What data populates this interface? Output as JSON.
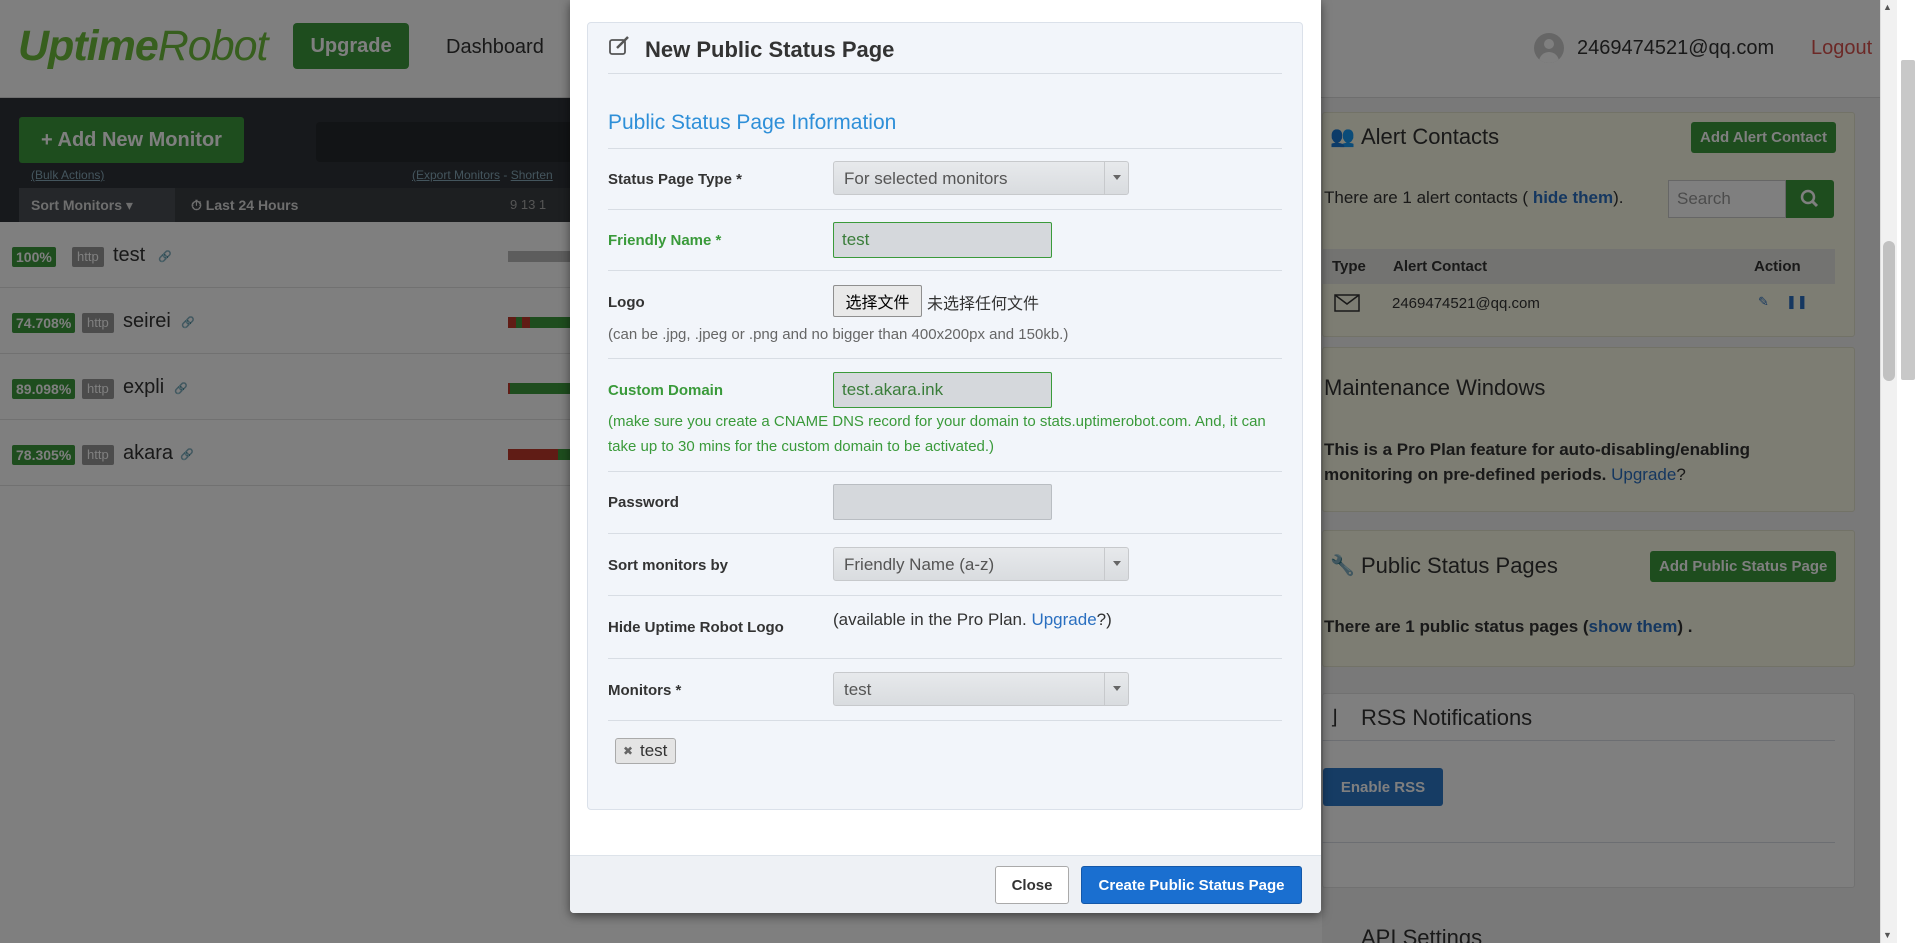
{
  "header": {
    "logo_part1": "Uptime",
    "logo_part2": "Robot",
    "upgrade_label": "Upgrade",
    "nav_dashboard": "Dashboard",
    "user_email": "2469474521@qq.com",
    "logout_label": "Logout"
  },
  "monitors_panel": {
    "add_button": "+ Add New Monitor",
    "bulk_actions": "(Bulk Actions)",
    "export_monitors": "(Export Monitors",
    "export_sep": " - ",
    "shorten": "Shorten",
    "sort_label": "Sort Monitors ▾",
    "period_label": "⏱ Last 24 Hours",
    "period_hours": "9   13   1",
    "monitors": [
      {
        "uptime": "100%",
        "type": "http",
        "name": "test",
        "status_color": "#3d9a3d"
      },
      {
        "uptime": "74.708%",
        "type": "http",
        "name": "seirei",
        "status_color": "#3d9a3d"
      },
      {
        "uptime": "89.098%",
        "type": "http",
        "name": "expli",
        "status_color": "#3d9a3d"
      },
      {
        "uptime": "78.305%",
        "type": "http",
        "name": "akara",
        "status_color": "#3d9a3d"
      }
    ]
  },
  "alert_contacts": {
    "title": "Alert Contacts",
    "add_button": "Add Alert Contact",
    "summary_prefix": "There are 1 alert contacts (",
    "summary_link": " hide them",
    "summary_suffix": ").",
    "search_placeholder": "Search",
    "col_type": "Type",
    "col_contact": "Alert Contact",
    "col_action": "Action",
    "contact_email": "2469474521@qq.com"
  },
  "maintenance": {
    "title": "Maintenance Windows",
    "text": "This is a Pro Plan feature for auto-disabling/enabling monitoring on pre-defined periods.",
    "upgrade_link": "Upgrade",
    "suffix": "?"
  },
  "status_pages": {
    "title": "Public Status Pages",
    "add_button": "Add Public Status Page",
    "text_prefix": "There are 1 public status pages (",
    "text_link": "show them",
    "text_suffix": ") ."
  },
  "rss": {
    "title": "RSS Notifications",
    "enable_button": "Enable RSS"
  },
  "api": {
    "title": "API Settings"
  },
  "modal": {
    "title": "New Public Status Page",
    "section_title": "Public Status Page Information",
    "status_page_type_label": "Status Page Type *",
    "status_page_type_value": "For selected monitors",
    "friendly_name_label": "Friendly Name *",
    "friendly_name_value": "test",
    "logo_label": "Logo",
    "file_button": "选择文件",
    "file_none": "未选择任何文件",
    "logo_help": "(can be .jpg, .jpeg or .png and no bigger than 400x200px and 150kb.)",
    "custom_domain_label": "Custom Domain",
    "custom_domain_value": "test.akara.ink",
    "custom_domain_help_1": "(make sure you create a CNAME DNS record for your domain to stats.uptimerobot.com. And, it can",
    "custom_domain_help_2": "take up to 30 mins for the custom domain to be activated.)",
    "password_label": "Password",
    "password_value": "",
    "sort_label": "Sort monitors by",
    "sort_value": "Friendly Name (a-z)",
    "hide_logo_label": "Hide Uptime Robot Logo",
    "hide_logo_prefix": "(available in the Pro Plan. ",
    "hide_logo_link": "Upgrade",
    "hide_logo_suffix": "?)",
    "monitors_label": "Monitors *",
    "monitors_value": "test",
    "selected_tag": "test",
    "close_button": "Close",
    "create_button": "Create Public Status Page"
  },
  "colors": {
    "brand_green": "#3d9a3d",
    "link_blue": "#2a6fc0",
    "primary_blue": "#1a6fd0",
    "section_blue": "#2e8fd8"
  }
}
